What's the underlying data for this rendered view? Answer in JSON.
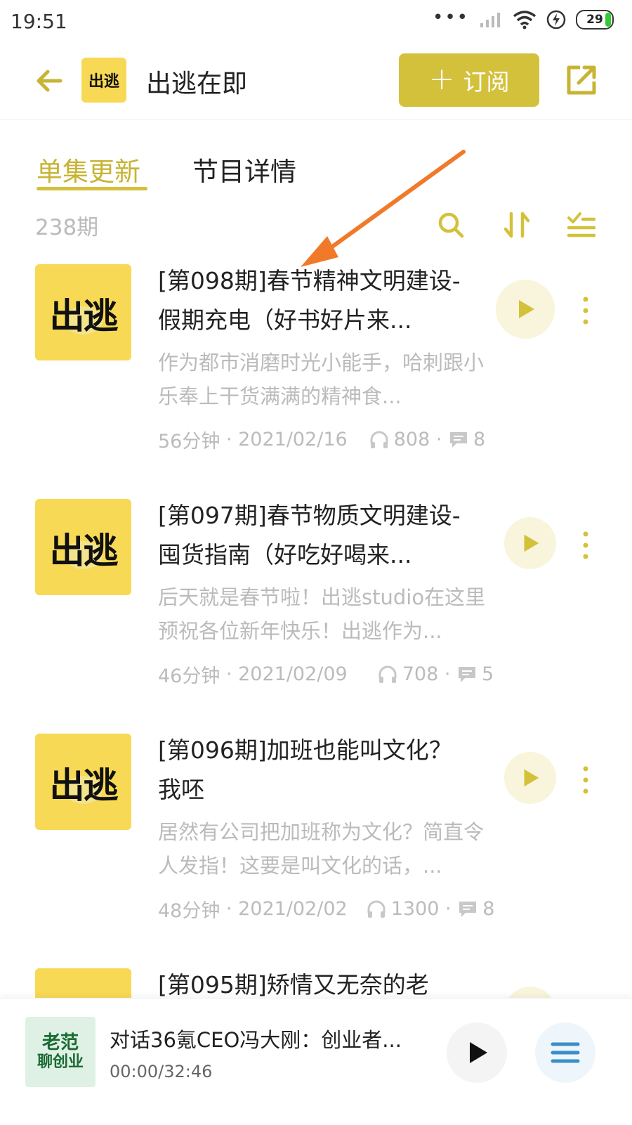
{
  "status": {
    "time": "19:51",
    "dots": "•••",
    "battery": "29"
  },
  "header": {
    "title": "出逃在即",
    "logo_text": "出逃",
    "subscribe_label": "订阅",
    "accent_color": "#d4c13b"
  },
  "tabs": [
    {
      "label": "单集更新",
      "active": true
    },
    {
      "label": "节目详情",
      "active": false
    }
  ],
  "toolbar": {
    "episode_count": "238期",
    "icons": [
      "search-icon",
      "sort-icon",
      "filter-list-icon"
    ]
  },
  "episodes": [
    {
      "cover_text": "出逃",
      "title": "[第098期]春节精神文明建设-假期充电（好书好片来...",
      "description": "作为都市消磨时光小能手，哈刺跟小乐奉上干货满满的精神食...",
      "duration": "56分钟",
      "date": "2021/02/16",
      "plays": "808",
      "comments": "8"
    },
    {
      "cover_text": "出逃",
      "title": "[第097期]春节物质文明建设-囤货指南（好吃好喝来...",
      "description": "后天就是春节啦！出逃studio在这里预祝各位新年快乐！出逃作为...",
      "duration": "46分钟",
      "date": "2021/02/09",
      "plays": "708",
      "comments": "5"
    },
    {
      "cover_text": "出逃",
      "title": "[第096期]加班也能叫文化？我呸",
      "description": "居然有公司把加班称为文化？简直令人发指！这要是叫文化的话，...",
      "duration": "48分钟",
      "date": "2021/02/02",
      "plays": "1300",
      "comments": "8"
    },
    {
      "cover_text": "",
      "title": "[第095期]矫情又无奈的老",
      "description": "",
      "duration": "",
      "date": "",
      "plays": "",
      "comments": ""
    }
  ],
  "player": {
    "cover_line1": "老范",
    "cover_line2": "聊创业",
    "title": "对话36氪CEO冯大刚：创业者...",
    "time": "00:00/32:46"
  }
}
